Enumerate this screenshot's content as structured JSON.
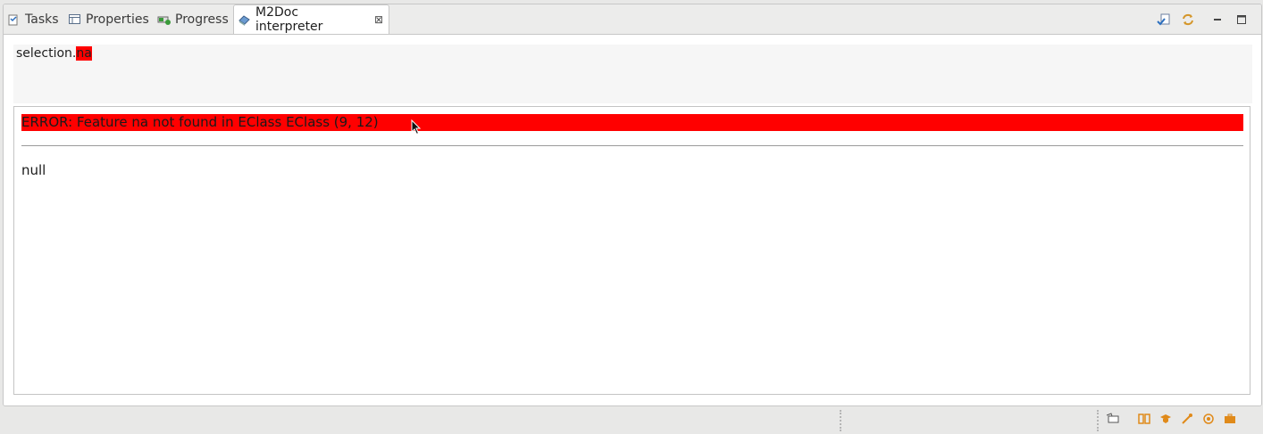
{
  "tabs": [
    {
      "label": "Tasks",
      "icon": "tasks-icon"
    },
    {
      "label": "Properties",
      "icon": "properties-icon"
    },
    {
      "label": "Progress",
      "icon": "progress-icon"
    },
    {
      "label": "M2Doc interpreter",
      "icon": "m2doc-icon",
      "active": true
    }
  ],
  "editor": {
    "text_prefix": "selection.",
    "text_highlight": "na"
  },
  "result": {
    "error": "ERROR: Feature na not found in EClass EClass (9, 12)",
    "value": "null"
  },
  "colors": {
    "error_highlight": "#ff0000",
    "accent_orange": "#e08a1a"
  }
}
